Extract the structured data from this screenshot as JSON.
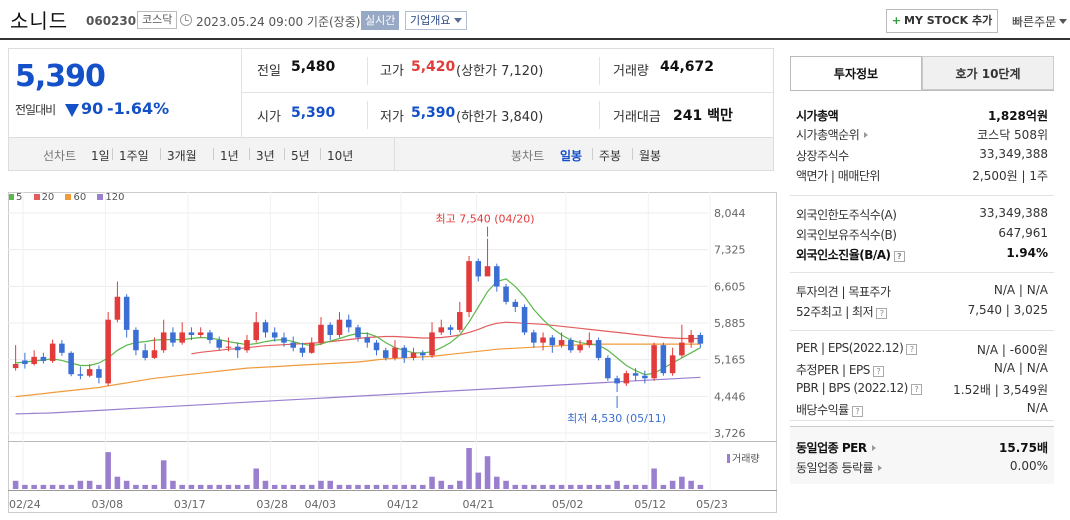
{
  "header": {
    "name": "소니드",
    "code": "060230",
    "market": "코스닥",
    "datetime": "2023.05.24 09:00  기준(장중)",
    "realtime": "실시간",
    "overview": "기업개요",
    "mystock": "MY STOCK 추가",
    "mystock_plus": "+",
    "quick_order": "빠른주문"
  },
  "price": {
    "current": "5,390",
    "prev_diff_label": "전일대비",
    "diff": "90",
    "rate": "-1.64%",
    "prev_label": "전일",
    "prev": "5,480",
    "high_label": "고가",
    "high": "5,420",
    "upper_limit": "(상한가 7,120)",
    "volume_label": "거래량",
    "volume": "44,672",
    "open_label": "시가",
    "open": "5,390",
    "low_label": "저가",
    "low": "5,390",
    "lower_limit": "(하한가 3,840)",
    "amount_label": "거래대금",
    "amount": "241 백만"
  },
  "tabs": {
    "line_label": "선차트",
    "line_periods": [
      "1일",
      "1주일",
      "3개월",
      "1년",
      "3년",
      "5년",
      "10년"
    ],
    "candle_label": "봉차트",
    "candle_periods": [
      "일봉",
      "주봉",
      "월봉"
    ],
    "active_candle": "일봉"
  },
  "legend": {
    "ma5": "5",
    "ma20": "20",
    "ma60": "60",
    "ma120": "120",
    "ma5_color": "#5bb84a",
    "ma20_color": "#e35d5d",
    "ma60_color": "#f19a3a",
    "ma120_color": "#9b7fcf",
    "volume": "거래량"
  },
  "chart_data": {
    "type": "candlestick",
    "y_ticks": [
      "8,044",
      "7,325",
      "6,605",
      "5,885",
      "5,165",
      "4,446",
      "3,726"
    ],
    "ylim": [
      3726,
      8044
    ],
    "x_ticks": [
      "02/24",
      "03/08",
      "03/17",
      "03/28",
      "04/03",
      "04/12",
      "04/21",
      "05/02",
      "05/12",
      "05/23"
    ],
    "high_annotation": "최고 7,540 (04/20)",
    "low_annotation": "최저 4,530 (05/11)",
    "up_color": "#e23b3b",
    "down_color": "#3b6fd4",
    "candles": [
      [
        5000,
        5080,
        5450,
        4950
      ],
      [
        5150,
        5080,
        5300,
        4990
      ],
      [
        5080,
        5220,
        5350,
        5050
      ],
      [
        5220,
        5140,
        5300,
        5090
      ],
      [
        5140,
        5480,
        5560,
        5100
      ],
      [
        5480,
        5300,
        5550,
        5240
      ],
      [
        5300,
        4880,
        5330,
        4840
      ],
      [
        4880,
        4850,
        5030,
        4780
      ],
      [
        4850,
        4980,
        5080,
        4820
      ],
      [
        4980,
        4810,
        5050,
        4700
      ],
      [
        4700,
        5950,
        6100,
        4650
      ],
      [
        5950,
        6400,
        6700,
        5900
      ],
      [
        6400,
        5750,
        6450,
        5600
      ],
      [
        5750,
        5350,
        5800,
        5250
      ],
      [
        5350,
        5200,
        5480,
        5150
      ],
      [
        5200,
        5350,
        5600,
        5180
      ],
      [
        5350,
        5700,
        5950,
        5300
      ],
      [
        5700,
        5500,
        5800,
        5420
      ],
      [
        5500,
        5700,
        5900,
        5460
      ],
      [
        5700,
        5650,
        5800,
        5550
      ],
      [
        5650,
        5700,
        5800,
        5600
      ],
      [
        5700,
        5550,
        5750,
        5480
      ],
      [
        5550,
        5400,
        5620,
        5350
      ],
      [
        5400,
        5420,
        5600,
        5330
      ],
      [
        5420,
        5350,
        5500,
        5200
      ],
      [
        5350,
        5550,
        5650,
        5300
      ],
      [
        5550,
        5900,
        6100,
        5500
      ],
      [
        5900,
        5700,
        5950,
        5600
      ],
      [
        5700,
        5600,
        5800,
        5520
      ],
      [
        5600,
        5500,
        5700,
        5420
      ],
      [
        5500,
        5400,
        5620,
        5330
      ],
      [
        5400,
        5300,
        5500,
        5220
      ],
      [
        5300,
        5500,
        5600,
        5280
      ],
      [
        5500,
        5850,
        6000,
        5450
      ],
      [
        5850,
        5650,
        5900,
        5550
      ],
      [
        5650,
        5950,
        6100,
        5600
      ],
      [
        5950,
        5800,
        6050,
        5700
      ],
      [
        5800,
        5600,
        5850,
        5520
      ],
      [
        5600,
        5500,
        5700,
        5400
      ],
      [
        5500,
        5350,
        5550,
        5250
      ],
      [
        5350,
        5200,
        5400,
        5150
      ],
      [
        5200,
        5400,
        5550,
        5150
      ],
      [
        5400,
        5200,
        5450,
        5100
      ],
      [
        5200,
        5300,
        5400,
        5150
      ],
      [
        5300,
        5250,
        5350,
        5150
      ],
      [
        5250,
        5700,
        5900,
        5200
      ],
      [
        5700,
        5800,
        5950,
        5650
      ],
      [
        5800,
        5750,
        5850,
        5650
      ],
      [
        5750,
        6100,
        6300,
        5700
      ],
      [
        6100,
        7100,
        7200,
        6000
      ],
      [
        7100,
        6800,
        7150,
        6700
      ],
      [
        6800,
        7000,
        7540,
        6900
      ],
      [
        7000,
        6600,
        7050,
        6500
      ],
      [
        6600,
        6300,
        6650,
        6250
      ],
      [
        6300,
        6200,
        6350,
        6100
      ],
      [
        6200,
        5700,
        6250,
        5650
      ],
      [
        5700,
        5500,
        5750,
        5400
      ],
      [
        5500,
        5600,
        5700,
        5350
      ],
      [
        5600,
        5450,
        5650,
        5300
      ],
      [
        5450,
        5550,
        5700,
        5400
      ],
      [
        5550,
        5350,
        5600,
        5300
      ],
      [
        5350,
        5450,
        5550,
        5300
      ],
      [
        5450,
        5550,
        5700,
        5400
      ],
      [
        5550,
        5200,
        5600,
        5150
      ],
      [
        5200,
        4800,
        5250,
        4750
      ],
      [
        4800,
        4700,
        4850,
        4530
      ],
      [
        4700,
        4900,
        4950,
        4650
      ],
      [
        4900,
        4850,
        5000,
        4750
      ],
      [
        4850,
        4800,
        4950,
        4700
      ],
      [
        4800,
        5450,
        5500,
        4750
      ],
      [
        5450,
        4900,
        5500,
        4850
      ],
      [
        4900,
        5250,
        5400,
        4850
      ],
      [
        5250,
        5500,
        5850,
        5200
      ],
      [
        5500,
        5650,
        5750,
        5400
      ],
      [
        5650,
        5480,
        5700,
        5400
      ]
    ],
    "ma5": [
      5100,
      5120,
      5140,
      5160,
      5180,
      5150,
      5100,
      5050,
      5050,
      5100,
      5200,
      5350,
      5450,
      5500,
      5520,
      5550,
      5560,
      5560,
      5560,
      5580,
      5600,
      5590,
      5560,
      5520,
      5490,
      5460,
      5480,
      5520,
      5550,
      5560,
      5520,
      5470,
      5440,
      5470,
      5530,
      5580,
      5640,
      5680,
      5680,
      5620,
      5500,
      5400,
      5350,
      5300,
      5300,
      5320,
      5400,
      5500,
      5650,
      5900,
      6200,
      6500,
      6700,
      6750,
      6600,
      6400,
      6150,
      5950,
      5780,
      5650,
      5550,
      5500,
      5470,
      5450,
      5350,
      5200,
      5050,
      4950,
      4870,
      4900,
      5000,
      5100,
      5200,
      5300,
      5400
    ],
    "ma20": [
      null,
      null,
      null,
      null,
      null,
      null,
      null,
      null,
      null,
      null,
      null,
      null,
      null,
      null,
      null,
      null,
      null,
      null,
      null,
      5280,
      5310,
      5330,
      5350,
      5370,
      5380,
      5400,
      5420,
      5440,
      5450,
      5460,
      5470,
      5480,
      5490,
      5500,
      5520,
      5540,
      5560,
      5580,
      5600,
      5610,
      5620,
      5620,
      5610,
      5600,
      5590,
      5590,
      5600,
      5620,
      5650,
      5700,
      5760,
      5830,
      5880,
      5900,
      5890,
      5880,
      5870,
      5860,
      5840,
      5820,
      5800,
      5780,
      5760,
      5740,
      5720,
      5700,
      5680,
      5660,
      5640,
      5620,
      5600,
      5590,
      5580,
      5580,
      5580
    ],
    "ma60": [
      4440,
      4460,
      4480,
      4500,
      4520,
      4540,
      4560,
      4580,
      4600,
      4620,
      4650,
      4680,
      4710,
      4740,
      4770,
      4800,
      4820,
      4840,
      4860,
      4880,
      4900,
      4920,
      4940,
      4960,
      4980,
      5000,
      5010,
      5020,
      5030,
      5040,
      5050,
      5060,
      5070,
      5080,
      5090,
      5100,
      5110,
      5120,
      5140,
      5160,
      5180,
      5190,
      5200,
      5210,
      5220,
      5230,
      5250,
      5270,
      5290,
      5310,
      5330,
      5350,
      5370,
      5380,
      5390,
      5400,
      5410,
      5420,
      5430,
      5440,
      5450,
      5460,
      5465,
      5470,
      5470,
      5470,
      5470,
      5470,
      5470,
      5470,
      5470,
      5470,
      5470,
      5470,
      5470
    ],
    "ma120": [
      4100,
      4105,
      4110,
      4115,
      4120,
      4130,
      4140,
      4150,
      4160,
      4170,
      4180,
      4190,
      4200,
      4210,
      4220,
      4230,
      4240,
      4250,
      4260,
      4270,
      4280,
      4290,
      4300,
      4310,
      4320,
      4330,
      4340,
      4350,
      4360,
      4370,
      4380,
      4390,
      4400,
      4410,
      4420,
      4430,
      4440,
      4450,
      4460,
      4470,
      4480,
      4490,
      4500,
      4510,
      4520,
      4530,
      4540,
      4550,
      4560,
      4570,
      4580,
      4590,
      4600,
      4610,
      4620,
      4630,
      4640,
      4650,
      4660,
      4670,
      4680,
      4690,
      4700,
      4710,
      4720,
      4730,
      4740,
      4750,
      4760,
      4770,
      4780,
      4790,
      4800,
      4810,
      4820
    ],
    "volumes": [
      2,
      1,
      1,
      1,
      1,
      1,
      1,
      2,
      2,
      1,
      9,
      3,
      2,
      1,
      1,
      1,
      7,
      2,
      1,
      1,
      1,
      1,
      1,
      1,
      1,
      1,
      5,
      2,
      1,
      1,
      1,
      1,
      1,
      2,
      2,
      1,
      1,
      1,
      1,
      1,
      1,
      1,
      1,
      1,
      1,
      3,
      2,
      1,
      2,
      10,
      4,
      8,
      3,
      2,
      1,
      1,
      1,
      1,
      1,
      1,
      1,
      1,
      1,
      1,
      1,
      2,
      1,
      1,
      1,
      5,
      1,
      2,
      3,
      2,
      1
    ]
  },
  "panel": {
    "tab_info": "투자정보",
    "tab_order": "호가 10단계",
    "rows": [
      {
        "k": "시가총액",
        "v": "1,828억원",
        "bold": true
      },
      {
        "k": "시가총액순위",
        "v": "코스닥 508위",
        "tri": true
      },
      {
        "k": "상장주식수",
        "v": "33,349,388"
      },
      {
        "k": "액면가 | 매매단위",
        "v": "2,500원 | 1주"
      },
      {
        "k": "외국인한도주식수(A)",
        "v": "33,349,388"
      },
      {
        "k": "외국인보유주식수(B)",
        "v": "647,961"
      },
      {
        "k": "외국인소진율(B/A)",
        "v": "1.94%",
        "bold": true,
        "info": true
      },
      {
        "k": "투자의견 | 목표주가",
        "v": "N/A | N/A"
      },
      {
        "k": "52주최고 | 최저",
        "v": "7,540 | 3,025",
        "info": true
      },
      {
        "k": "PER | EPS(2022.12)",
        "v": "N/A | -600원",
        "info": true
      },
      {
        "k": "추정PER | EPS",
        "v": "N/A | N/A",
        "info": true
      },
      {
        "k": "PBR | BPS (2022.12)",
        "v": "1.52배 | 3,549원",
        "info": true
      },
      {
        "k": "배당수익률",
        "v": "N/A",
        "info": true
      },
      {
        "k": "동일업종 PER",
        "v": "15.75배",
        "bold": true,
        "tri": true
      },
      {
        "k": "동일업종 등락률",
        "v": "0.00%",
        "tri": true
      }
    ]
  }
}
